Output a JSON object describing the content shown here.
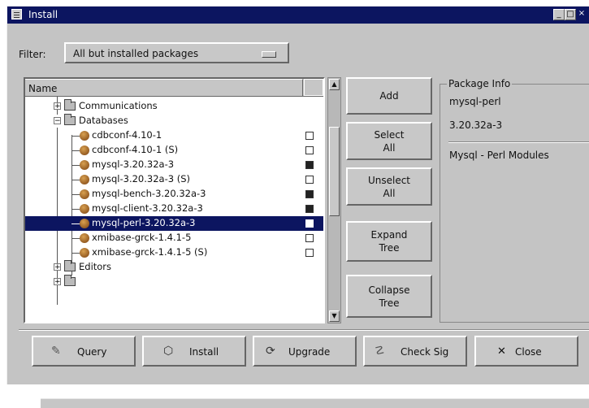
{
  "window": {
    "title": "Install"
  },
  "filter": {
    "label": "Filter:",
    "value": "All but installed packages"
  },
  "tree": {
    "header_name": "Name",
    "rows": [
      {
        "label": "Communications",
        "type": "group",
        "selected": false
      },
      {
        "label": "Databases",
        "type": "group",
        "selected": false
      },
      {
        "label": "cdbconf-4.10-1",
        "type": "package",
        "checked": false,
        "selected": false
      },
      {
        "label": "cdbconf-4.10-1 (S)",
        "type": "package",
        "checked": false,
        "selected": false
      },
      {
        "label": "mysql-3.20.32a-3",
        "type": "package",
        "checked": true,
        "selected": false
      },
      {
        "label": "mysql-3.20.32a-3 (S)",
        "type": "package",
        "checked": false,
        "selected": false
      },
      {
        "label": "mysql-bench-3.20.32a-3",
        "type": "package",
        "checked": true,
        "selected": false
      },
      {
        "label": "mysql-client-3.20.32a-3",
        "type": "package",
        "checked": true,
        "selected": false
      },
      {
        "label": "mysql-perl-3.20.32a-3",
        "type": "package",
        "checked": false,
        "selected": true
      },
      {
        "label": "xmibase-grck-1.4.1-5",
        "type": "package",
        "checked": false,
        "selected": false
      },
      {
        "label": "xmibase-grck-1.4.1-5 (S)",
        "type": "package",
        "checked": false,
        "selected": false
      },
      {
        "label": "Editors",
        "type": "group",
        "selected": false
      }
    ]
  },
  "side_buttons": {
    "add": "Add",
    "select_all": [
      "Select",
      "All"
    ],
    "unselect_all": [
      "Unselect",
      "All"
    ],
    "expand_tree": [
      "Expand",
      "Tree"
    ],
    "collapse_tree": [
      "Collapse",
      "Tree"
    ]
  },
  "package_info": {
    "legend": "Package Info",
    "name": "mysql-perl",
    "version": "3.20.32a-3",
    "description": "Mysql - Perl Modules"
  },
  "bottom_buttons": {
    "query": "Query",
    "install": "Install",
    "upgrade": "Upgrade",
    "check_sig": "Check Sig",
    "close": "Close"
  },
  "icons": {
    "folder": "folder-icon",
    "package": "package-icon",
    "query": "query-icon",
    "install": "install-icon",
    "upgrade": "upgrade-icon",
    "check_sig": "check-sig-icon",
    "close": "close-x-icon"
  },
  "colors": {
    "title_bar": "#0c1560",
    "selection": "#0c1560",
    "window_bg": "#c4c4c4"
  }
}
